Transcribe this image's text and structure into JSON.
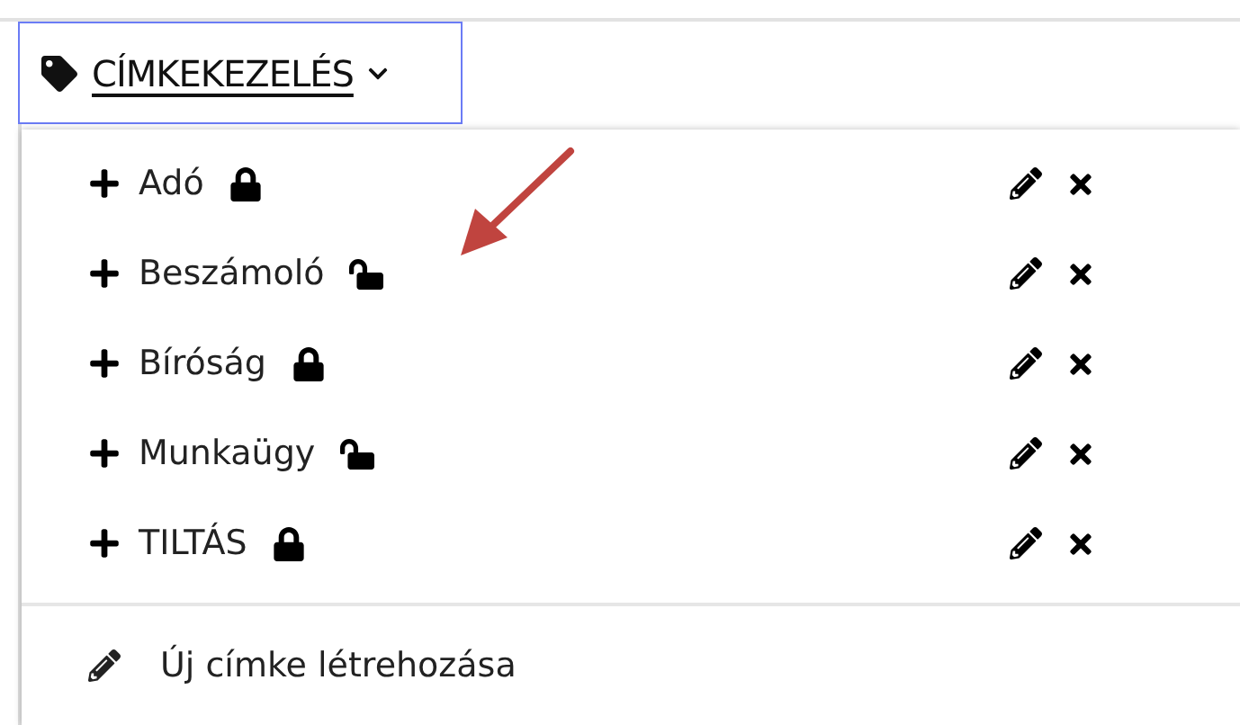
{
  "menu_button": {
    "label": "CÍMKEKEZELÉS"
  },
  "tags": [
    {
      "name": "Adó",
      "locked": true
    },
    {
      "name": "Beszámoló",
      "locked": false
    },
    {
      "name": "Bíróság",
      "locked": true
    },
    {
      "name": "Munkaügy",
      "locked": false
    },
    {
      "name": "TILTÁS",
      "locked": true
    }
  ],
  "create_item": {
    "label": "Új címke létrehozása"
  }
}
